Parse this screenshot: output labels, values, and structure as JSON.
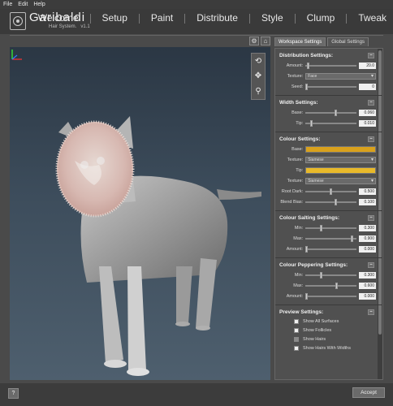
{
  "menu": {
    "file": "File",
    "edit": "Edit",
    "help": "Help"
  },
  "app": {
    "name": "Garibaldi",
    "subtitle": "Hair System.",
    "version": "v1.1"
  },
  "tabs": [
    "Welcome",
    "Setup",
    "Paint",
    "Distribute",
    "Style",
    "Clump",
    "Tweak"
  ],
  "icons": {
    "viewport_tools": [
      "rotate-icon",
      "move-icon",
      "zoom-icon"
    ],
    "top": [
      "settings-icon",
      "home-icon"
    ]
  },
  "panel_tabs": {
    "workspace": "Workspace Settings",
    "global": "Global Settings"
  },
  "distribution": {
    "title": "Distribution Settings:",
    "amount_label": "Amount:",
    "amount": "20.0",
    "texture_label": "Texture:",
    "texture": "Face",
    "seed_label": "Seed:",
    "seed": "0"
  },
  "width": {
    "title": "Width Settings:",
    "base_label": "Base:",
    "base": "0.060",
    "tip_label": "Tip:",
    "tip": "0.010"
  },
  "colour": {
    "title": "Colour Settings:",
    "base_label": "Base:",
    "base_color": "#d9a11c",
    "texture_label": "Texture:",
    "texture": "Siamese",
    "tip_label": "Tip:",
    "tip_color": "#e8b92a",
    "texture2_label": "Texture:",
    "texture2": "Siamese",
    "rootdark_label": "Root Dark:",
    "rootdark": "0.500",
    "blendbias_label": "Blend Bias:",
    "blendbias": "0.100"
  },
  "salting": {
    "title": "Colour Salting Settings:",
    "min_label": "Min:",
    "min": "0.300",
    "max_label": "Max:",
    "max": "0.900",
    "amount_label": "Amount:",
    "amount": "0.000"
  },
  "peppering": {
    "title": "Colour Peppering Settings:",
    "min_label": "Min:",
    "min": "0.300",
    "max_label": "Max:",
    "max": "0.600",
    "amount_label": "Amount:",
    "amount": "0.000"
  },
  "preview": {
    "title": "Preview Settings:",
    "show_all_surfaces": "Show All Surfaces",
    "show_follicles": "Show Follicles",
    "show_hairs": "Show Hairs",
    "show_hairs_widths": "Show Hairs With Widths"
  },
  "footer": {
    "help": "?",
    "accept": "Accept"
  }
}
